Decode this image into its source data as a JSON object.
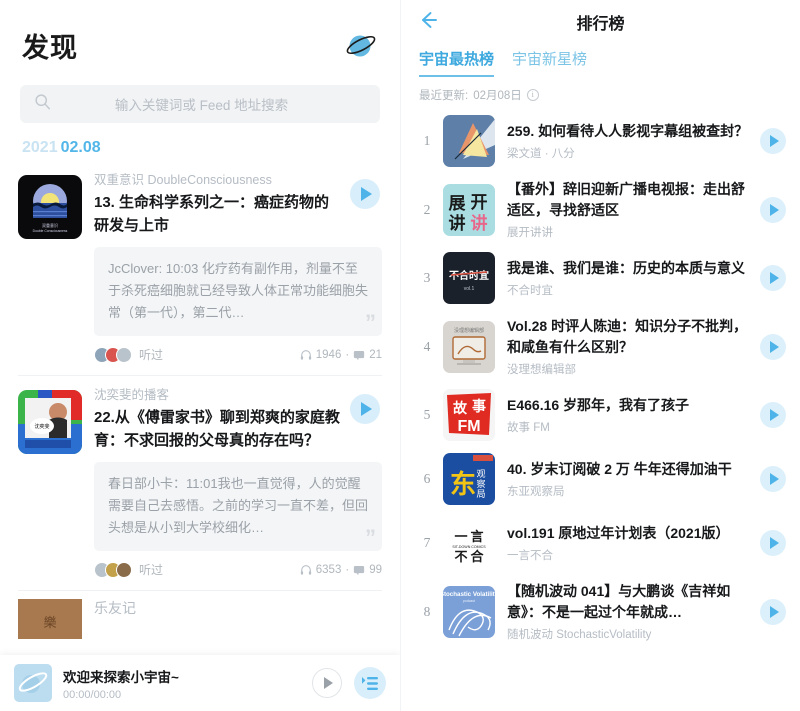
{
  "left": {
    "title": "发现",
    "planet_icon": "planet-icon",
    "search": {
      "icon": "search-icon",
      "placeholder": "输入关键词或 Feed 地址搜索",
      "value": ""
    },
    "date": {
      "year": "2021",
      "day": "02.08"
    },
    "feed": [
      {
        "podcast": "双重意识 DoubleConsciousness",
        "title": "13. 生命科学系列之一：癌症药物的研发与上市",
        "quote": "JcClover:  10:03 化疗药有副作用，剂量不至于杀死癌细胞就已经导致人体正常功能细胞失常（第一代），第二代…",
        "listened_label": "听过",
        "plays": "1946",
        "comments": "21",
        "cover_colors": [
          "#0a0a0c",
          "#9aa8dd",
          "#f3e47a",
          "#2d4f9e"
        ]
      },
      {
        "podcast": "沈奕斐的播客",
        "title": "22.从《傅雷家书》聊到郑爽的家庭教育：不求回报的父母真的存在吗？",
        "quote": "春日部小卡：11:01我也一直觉得，人的觉醒需要自己去感悟。之前的学习一直不差，但回头想是从小到大学校细化…",
        "listened_label": "听过",
        "plays": "6353",
        "comments": "99",
        "cover_colors": [
          "#3bb44a",
          "#e02b28",
          "#2b57c4",
          "#ffffff"
        ]
      }
    ],
    "partial_card": {
      "podcast": "乐友记",
      "cover_color": "#a8794f"
    },
    "player": {
      "title": "欢迎来探索小宇宙~",
      "time": "00:00/00:00",
      "play_icon": "play-icon",
      "playlist_icon": "playlist-icon"
    }
  },
  "right": {
    "back_icon": "back-arrow-icon",
    "title": "排行榜",
    "tabs": [
      {
        "label": "宇宙最热榜",
        "active": true
      },
      {
        "label": "宇宙新星榜",
        "active": false
      }
    ],
    "updated": {
      "label": "最近更新:",
      "date": "02月08日",
      "info_icon": "info-icon",
      "info_glyph": "i"
    },
    "items": [
      {
        "rank": "1",
        "title": "259. 如何看待人人影视字幕组被查封？",
        "podcast": "梁文道 · 八分",
        "cover_colors": [
          "#5d7fa8",
          "#e8956a",
          "#f5e6a0"
        ]
      },
      {
        "rank": "2",
        "title": "【番外】辞旧迎新广播电视报：走出舒适区，寻找舒适区",
        "podcast": "展开讲讲",
        "cover_colors": [
          "#a9dde2",
          "#1a1a1a",
          "#e8668a"
        ]
      },
      {
        "rank": "3",
        "title": "我是谁、我们是谁：历史的本质与意义",
        "podcast": "不合时宜",
        "cover_colors": [
          "#1b212b",
          "#ffffff",
          "#d94f3d"
        ]
      },
      {
        "rank": "4",
        "title": "Vol.28 时评人陈迪：知识分子不批判，和咸鱼有什么区别？",
        "podcast": "没理想编辑部",
        "cover_colors": [
          "#d8d4cf",
          "#b06a35",
          "#f0ece6"
        ]
      },
      {
        "rank": "5",
        "title": "E466.16 岁那年，我有了孩子",
        "podcast": "故事 FM",
        "cover_colors": [
          "#e02b22",
          "#ffffff",
          "#f5f5f5"
        ]
      },
      {
        "rank": "6",
        "title": "40. 岁末订阅破 2 万 牛年还得加油干",
        "podcast": "东亚观察局",
        "cover_colors": [
          "#1b4ea0",
          "#f2c514",
          "#7fb3dd"
        ]
      },
      {
        "rank": "7",
        "title": "vol.191 原地过年计划表（2021版）",
        "podcast": "一言不合",
        "cover_colors": [
          "#ffffff",
          "#1a1a1a",
          "#f2f2f2"
        ]
      },
      {
        "rank": "8",
        "title": "【随机波动 041】与大鹏谈《吉祥如意》：不是一起过个年就成…",
        "podcast": "随机波动 StochasticVolatility",
        "cover_colors": [
          "#7ba0d8",
          "#ffffff",
          "#5f86c4"
        ]
      }
    ]
  }
}
